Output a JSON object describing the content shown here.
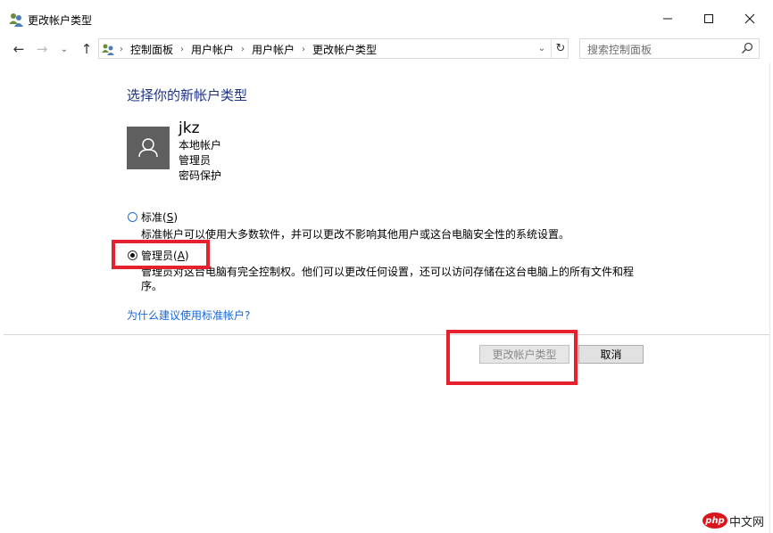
{
  "window": {
    "title": "更改帐户类型",
    "minimize_icon": "minimize-icon",
    "maximize_icon": "maximize-icon",
    "close_icon": "close-icon"
  },
  "address_bar": {
    "breadcrumb": [
      "控制面板",
      "用户帐户",
      "用户帐户",
      "更改帐户类型"
    ],
    "search_placeholder": "搜索控制面板"
  },
  "main": {
    "heading": "选择你的新帐户类型",
    "user": {
      "name": "jkz",
      "lines": [
        "本地帐户",
        "管理员",
        "密码保护"
      ]
    },
    "options": [
      {
        "label": "标准",
        "access_key": "S",
        "description": "标准帐户可以使用大多数软件，并可以更改不影响其他用户或这台电脑安全性的系统设置。",
        "selected": false
      },
      {
        "label": "管理员",
        "access_key": "A",
        "description": "管理员对这台电脑有完全控制权。他们可以更改任何设置，还可以访问存储在这台电脑上的所有文件和程序。",
        "selected": true
      }
    ],
    "link": "为什么建议使用标准帐户?"
  },
  "buttons": {
    "change": "更改帐户类型",
    "cancel": "取消"
  },
  "watermark": {
    "logo": "php",
    "text": "中文网"
  },
  "colors": {
    "highlight": "#e4212c",
    "heading": "#1e3287",
    "link": "#1a65d5"
  }
}
